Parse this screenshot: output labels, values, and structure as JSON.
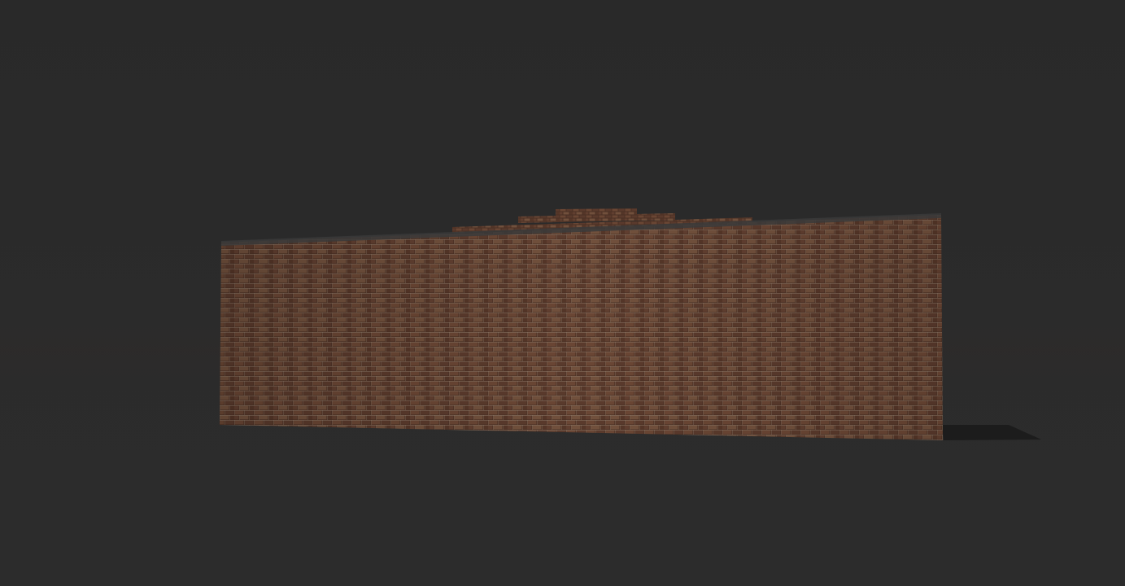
{
  "scene": {
    "background_color": "#2b2b2b",
    "object": "brick-wall",
    "brick_color": "#5e3f31",
    "mortar_color": "#b39e8a",
    "cap_color": "#3a3a3a"
  }
}
